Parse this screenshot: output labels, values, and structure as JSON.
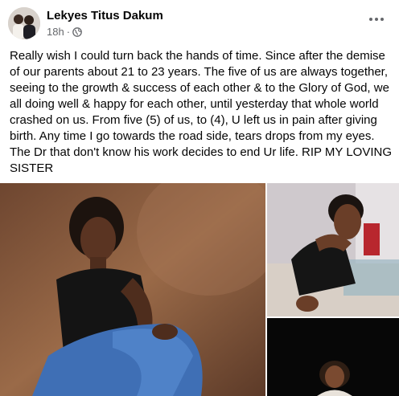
{
  "post": {
    "author_name": "Lekyes Titus Dakum",
    "time": "18h",
    "separator": "·",
    "privacy_icon": "globe-icon",
    "more_icon": "more-options-icon",
    "text": "Really wish I could turn back the hands of time. Since after the demise of our parents about 21 to 23 years. The five of us are always together, seeing to the growth & success of each other & to the Glory of God, we all doing well & happy for each other, until yesterday that whole world crashed on us. From five (5) of us, to (4), U left us in pain after giving birth. Any time I go towards the road side, tears drops from my eyes. The Dr that don't know his work decides to end Ur life. RIP MY LOVING SISTER"
  },
  "colors": {
    "text": "#050505",
    "secondary_text": "#65676b",
    "background": "#ffffff"
  },
  "photos": [
    {
      "name": "photo-woman-seated-jeans"
    },
    {
      "name": "photo-woman-at-counter"
    },
    {
      "name": "photo-woman-dark-background"
    }
  ]
}
